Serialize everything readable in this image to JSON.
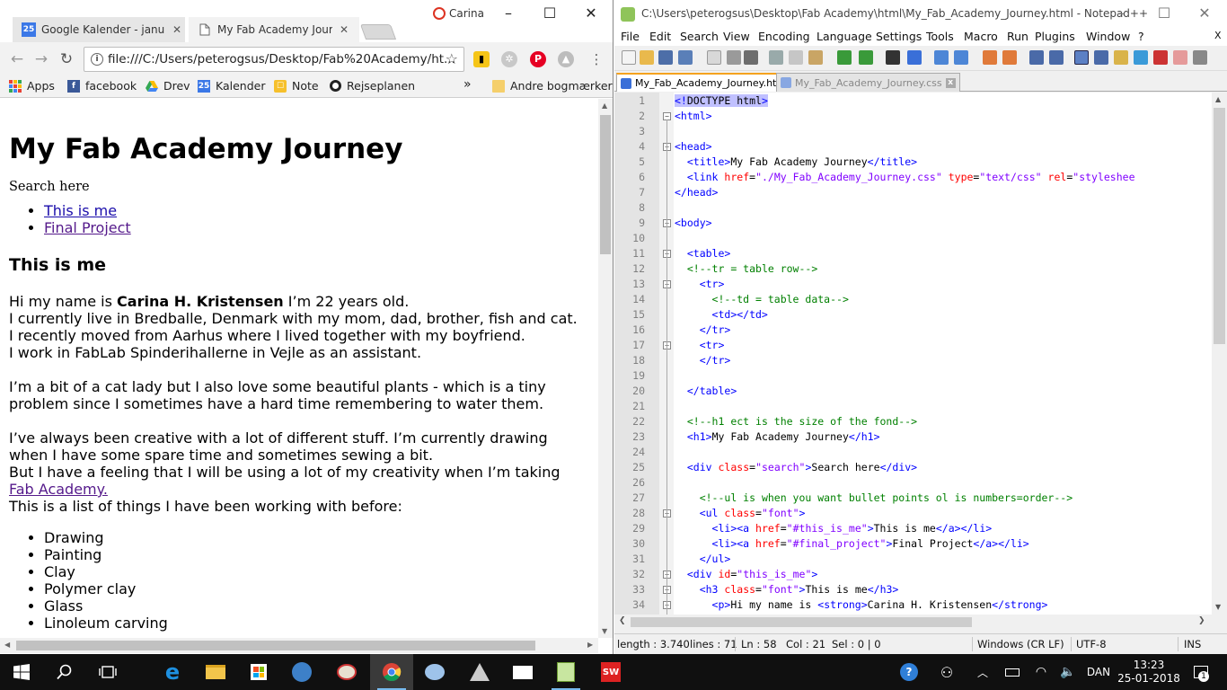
{
  "chrome": {
    "user_name": "Carina",
    "tabs": [
      {
        "title": "Google Kalender - januar",
        "icon_text": "25",
        "icon_color": "#3b78e7"
      },
      {
        "title": "My Fab Academy Journey",
        "icon_text": "",
        "icon_color": "#ffffff"
      }
    ],
    "url": "file:///C:/Users/peterogsus/Desktop/Fab%20Academy/ht...",
    "bookmarks": [
      {
        "label": "Apps",
        "icon": "apps-grid-icon"
      },
      {
        "label": "facebook",
        "icon": "facebook-icon"
      },
      {
        "label": "Drev",
        "icon": "drive-icon"
      },
      {
        "label": "Kalender",
        "icon": "calendar-icon"
      },
      {
        "label": "Note",
        "icon": "note-icon"
      },
      {
        "label": "Rejseplanen",
        "icon": "rejseplanen-icon"
      }
    ],
    "bookmarks_overflow": "»",
    "other_bookmarks": "Andre bogmærker"
  },
  "page": {
    "heading": "My Fab Academy Journey",
    "search_text": "Search here",
    "nav_links": [
      "This is me",
      "Final Project"
    ],
    "section_title": "This is me",
    "intro_prefix": "Hi my name is ",
    "intro_name": "Carina H. Kristensen",
    "intro_suffix": " I’m 22 years old.",
    "intro_lines": [
      "I currently live in Bredballe, Denmark with my mom, dad, brother, fish and cat.",
      "I recently moved from Aarhus where I lived together with my boyfriend.",
      "I work in FabLab Spinderihallerne in Vejle as an assistant."
    ],
    "para2": "I’m a bit of a cat lady but I also love some beautiful plants - which is a tiny problem since I sometimes have a hard time remembering to water them.",
    "para3_line1": "I’ve always been creative with a lot of different stuff. I’m currently drawing when I have some spare time and sometimes sewing a bit.",
    "para3_line2": "But I have a feeling that I will be using a lot of my creativity when I’m taking ",
    "para3_link": "Fab Academy.",
    "para3_line3": "This is a list of things I have been working with before:",
    "skills": [
      "Drawing",
      "Painting",
      "Clay",
      "Polymer clay",
      "Glass",
      "Linoleum carving"
    ]
  },
  "npp": {
    "title": "C:\\Users\\peterogsus\\Desktop\\Fab Academy\\html\\My_Fab_Academy_Journey.html - Notepad++",
    "menu": [
      "File",
      "Edit",
      "Search",
      "View",
      "Encoding",
      "Language",
      "Settings",
      "Tools",
      "Macro",
      "Run",
      "Plugins",
      "Window",
      "?"
    ],
    "menu_close": "X",
    "tabs": [
      "My_Fab_Academy_Journey.html",
      "My_Fab_Academy_Journey.css"
    ],
    "status": {
      "length": "length : 3.740",
      "lines": "lines : 71",
      "ln": "Ln : 58",
      "col": "Col : 21",
      "sel": "Sel : 0 | 0",
      "eol": "Windows (CR LF)",
      "encoding": "UTF-8",
      "mode": "INS"
    },
    "code_lines": [
      {
        "n": "1",
        "html": "<span class=\"hl\"><span class=\"tag\">&lt;!</span>DOCTYPE html<span class=\"tag\">&gt;</span></span>"
      },
      {
        "n": "2",
        "html": "<span class=\"tag\">&lt;html&gt;</span>"
      },
      {
        "n": "3",
        "html": ""
      },
      {
        "n": "4",
        "html": "<span class=\"tag\">&lt;head&gt;</span>"
      },
      {
        "n": "5",
        "html": "  <span class=\"tag\">&lt;title&gt;</span>My Fab Academy Journey<span class=\"tag\">&lt;/title&gt;</span>"
      },
      {
        "n": "6",
        "html": "  <span class=\"tag\">&lt;link</span> <span class=\"attr\">href</span>=<span class=\"val\">\"./My_Fab_Academy_Journey.css\"</span> <span class=\"attr\">type</span>=<span class=\"val\">\"text/css\"</span> <span class=\"attr\">rel</span>=<span class=\"val\">\"styleshee</span>"
      },
      {
        "n": "7",
        "html": "<span class=\"tag\">&lt;/head&gt;</span>"
      },
      {
        "n": "8",
        "html": ""
      },
      {
        "n": "9",
        "html": "<span class=\"tag\">&lt;body&gt;</span>"
      },
      {
        "n": "10",
        "html": ""
      },
      {
        "n": "11",
        "html": "  <span class=\"tag\">&lt;table&gt;</span>"
      },
      {
        "n": "12",
        "html": "  <span class=\"cmt\">&lt;!--tr = table row--&gt;</span>"
      },
      {
        "n": "13",
        "html": "    <span class=\"tag\">&lt;tr&gt;</span>"
      },
      {
        "n": "14",
        "html": "      <span class=\"cmt\">&lt;!--td = table data--&gt;</span>"
      },
      {
        "n": "15",
        "html": "      <span class=\"tag\">&lt;td&gt;&lt;/td&gt;</span>"
      },
      {
        "n": "16",
        "html": "    <span class=\"tag\">&lt;/tr&gt;</span>"
      },
      {
        "n": "17",
        "html": "    <span class=\"tag\">&lt;tr&gt;</span>"
      },
      {
        "n": "18",
        "html": "    <span class=\"tag\">&lt;/tr&gt;</span>"
      },
      {
        "n": "19",
        "html": ""
      },
      {
        "n": "20",
        "html": "  <span class=\"tag\">&lt;/table&gt;</span>"
      },
      {
        "n": "21",
        "html": ""
      },
      {
        "n": "22",
        "html": "  <span class=\"cmt\">&lt;!--h1 ect is the size of the fond--&gt;</span>"
      },
      {
        "n": "23",
        "html": "  <span class=\"tag\">&lt;h1&gt;</span>My Fab Academy Journey<span class=\"tag\">&lt;/h1&gt;</span>"
      },
      {
        "n": "24",
        "html": ""
      },
      {
        "n": "25",
        "html": "  <span class=\"tag\">&lt;div</span> <span class=\"attr\">class</span>=<span class=\"val\">\"search\"</span><span class=\"tag\">&gt;</span>Search here<span class=\"tag\">&lt;/div&gt;</span>"
      },
      {
        "n": "26",
        "html": ""
      },
      {
        "n": "27",
        "html": "    <span class=\"cmt\">&lt;!--ul is when you want bullet points ol is numbers=order--&gt;</span>"
      },
      {
        "n": "28",
        "html": "    <span class=\"tag\">&lt;ul</span> <span class=\"attr\">class</span>=<span class=\"val\">\"font\"</span><span class=\"tag\">&gt;</span>"
      },
      {
        "n": "29",
        "html": "      <span class=\"tag\">&lt;li&gt;&lt;a</span> <span class=\"attr\">href</span>=<span class=\"val\">\"#this_is_me\"</span><span class=\"tag\">&gt;</span>This is me<span class=\"tag\">&lt;/a&gt;&lt;/li&gt;</span>"
      },
      {
        "n": "30",
        "html": "      <span class=\"tag\">&lt;li&gt;&lt;a</span> <span class=\"attr\">href</span>=<span class=\"val\">\"#final_project\"</span><span class=\"tag\">&gt;</span>Final Project<span class=\"tag\">&lt;/a&gt;&lt;/li&gt;</span>"
      },
      {
        "n": "31",
        "html": "    <span class=\"tag\">&lt;/ul&gt;</span>"
      },
      {
        "n": "32",
        "html": "  <span class=\"tag\">&lt;div</span> <span class=\"attr\">id</span>=<span class=\"val\">\"this_is_me\"</span><span class=\"tag\">&gt;</span>"
      },
      {
        "n": "33",
        "html": "    <span class=\"tag\">&lt;h3</span> <span class=\"attr\">class</span>=<span class=\"val\">\"font\"</span><span class=\"tag\">&gt;</span>This is me<span class=\"tag\">&lt;/h3&gt;</span>"
      },
      {
        "n": "34",
        "html": "      <span class=\"tag\">&lt;p&gt;</span>Hi my name is <span class=\"tag\">&lt;strong&gt;</span>Carina H. Kristensen<span class=\"tag\">&lt;/strong&gt;</span>"
      }
    ]
  },
  "taskbar": {
    "time": "13:23",
    "date": "25-01-2018",
    "language": "DAN",
    "notification_count": "1"
  }
}
